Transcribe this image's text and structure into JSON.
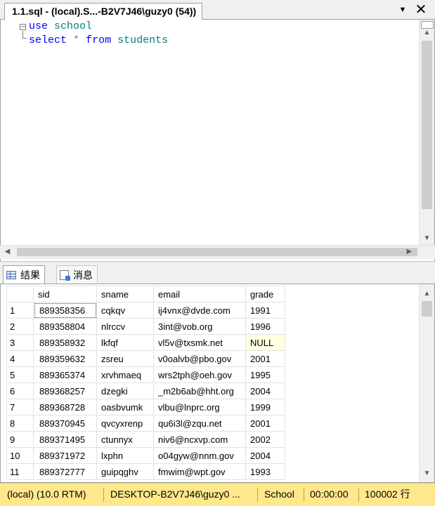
{
  "tab": {
    "title": "1.1.sql - (local).S...-B2V7J46\\guzy0 (54))"
  },
  "editor": {
    "line1": {
      "kw": "use",
      "id": "school"
    },
    "line2": {
      "kw1": "select",
      "op": "*",
      "kw2": "from",
      "id": "students"
    }
  },
  "results_tabs": {
    "results": "结果",
    "messages": "消息"
  },
  "grid": {
    "columns": [
      "sid",
      "sname",
      "email",
      "grade"
    ],
    "rows": [
      [
        "1",
        "889358356",
        "cqkqv",
        "ij4vnx@dvde.com",
        "1991"
      ],
      [
        "2",
        "889358804",
        "nlrccv",
        "3int@vob.org",
        "1996"
      ],
      [
        "3",
        "889358932",
        "lkfqf",
        "vl5v@txsmk.net",
        "NULL"
      ],
      [
        "4",
        "889359632",
        "zsreu",
        "v0oalvb@pbo.gov",
        "2001"
      ],
      [
        "5",
        "889365374",
        "xrvhmaeq",
        "wrs2tph@oeh.gov",
        "1995"
      ],
      [
        "6",
        "889368257",
        "dzegki",
        "_m2b6ab@hht.org",
        "2004"
      ],
      [
        "7",
        "889368728",
        "oasbvumk",
        "vlbu@lnprc.org",
        "1999"
      ],
      [
        "8",
        "889370945",
        "qvcyxrenp",
        "qu6i3l@zqu.net",
        "2001"
      ],
      [
        "9",
        "889371495",
        "ctunnyx",
        "niv6@ncxvp.com",
        "2002"
      ],
      [
        "10",
        "889371972",
        "lxphn",
        "o04gyw@nnm.gov",
        "2004"
      ],
      [
        "11",
        "889372777",
        "guipqghv",
        "fmwim@wpt.gov",
        "1993"
      ]
    ]
  },
  "status": {
    "server": "(local) (10.0 RTM)",
    "user": "DESKTOP-B2V7J46\\guzy0 ...",
    "database": "School",
    "elapsed": "00:00:00",
    "rows": "100002 行"
  },
  "colors": {
    "status_bg": "#ffe88c",
    "keyword": "#0000ff",
    "identifier": "#008080",
    "null_bg": "#ffffe1"
  }
}
